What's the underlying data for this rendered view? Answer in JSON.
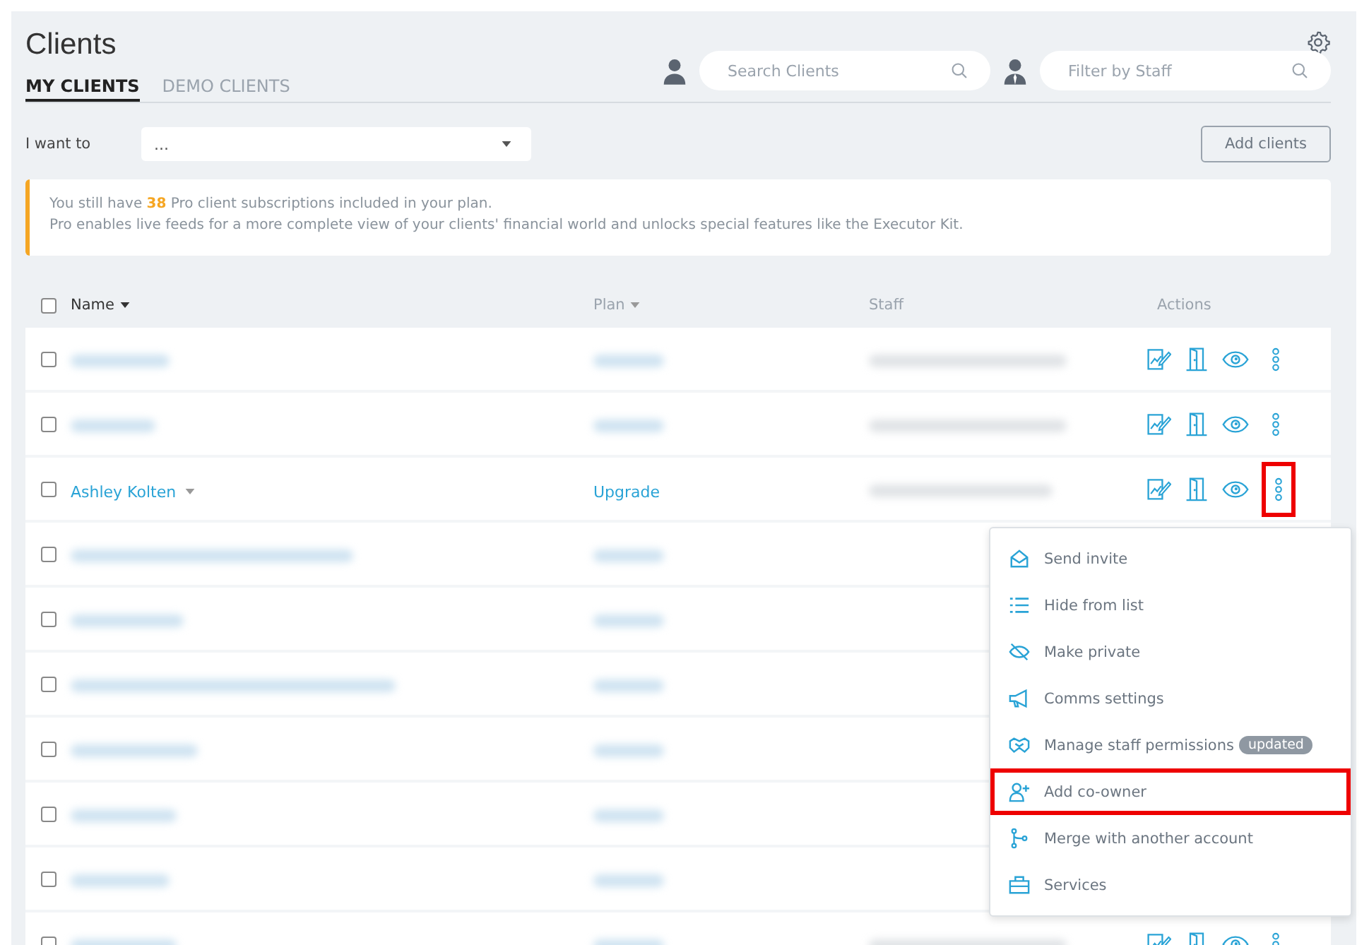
{
  "page": {
    "title": "Clients"
  },
  "tabs": [
    {
      "label": "MY CLIENTS",
      "selected": true
    },
    {
      "label": "DEMO CLIENTS",
      "selected": false
    }
  ],
  "search": {
    "placeholder": "Search Clients"
  },
  "staff_filter": {
    "placeholder": "Filter by Staff"
  },
  "action_select": {
    "label": "I want to",
    "value": "..."
  },
  "add_button": "Add clients",
  "notice": {
    "line_1": "You still have **38** Pro client subscriptions included in your plan.",
    "line_2": "Pro enables live feeds for a more complete view of your clients' financial world and unlocks special features like the Executor Kit."
  },
  "table": {
    "select_all": {
      "checked": false
    },
    "columns": [
      {
        "label": "Name",
        "sortable": true
      },
      {
        "label": "Plan",
        "sortable": true
      },
      {
        "label": "Staff",
        "sortable": false
      },
      {
        "label": "Actions",
        "sortable": false
      }
    ],
    "rows": [
      {
        "kind": "blurred",
        "checked": false,
        "actions": true,
        "menu_highlighted": false
      },
      {
        "kind": "blurred",
        "checked": false,
        "actions": true,
        "menu_highlighted": false
      },
      {
        "kind": "client",
        "name": "Ashley Kolten",
        "plan": "Upgrade",
        "checked": false,
        "actions": true,
        "menu_highlighted": true
      },
      {
        "kind": "blurred",
        "checked": false,
        "actions": false
      },
      {
        "kind": "blurred",
        "checked": false,
        "actions": false
      },
      {
        "kind": "blurred",
        "checked": false,
        "actions": false
      },
      {
        "kind": "blurred",
        "checked": false,
        "actions": false
      },
      {
        "kind": "blurred",
        "checked": false,
        "actions": false
      },
      {
        "kind": "blurred",
        "checked": false,
        "actions": false
      },
      {
        "kind": "blurred",
        "checked": false,
        "actions": true,
        "menu_highlighted": false
      }
    ]
  },
  "menu": {
    "items": [
      {
        "kind": "invite",
        "label": "Send invite",
        "highlighted": false
      },
      {
        "kind": "list",
        "label": "Hide from list",
        "highlighted": false
      },
      {
        "kind": "private",
        "label": "Make private",
        "highlighted": false
      },
      {
        "kind": "comms",
        "label": "Comms settings",
        "highlighted": false
      },
      {
        "kind": "permissions",
        "label": "Manage staff permissions",
        "badge": "updated",
        "highlighted": false
      },
      {
        "kind": "coowner",
        "label": "Add co-owner",
        "highlighted": true
      },
      {
        "kind": "merge",
        "label": "Merge with another account",
        "highlighted": false
      },
      {
        "kind": "services",
        "label": "Services",
        "highlighted": false
      }
    ]
  }
}
